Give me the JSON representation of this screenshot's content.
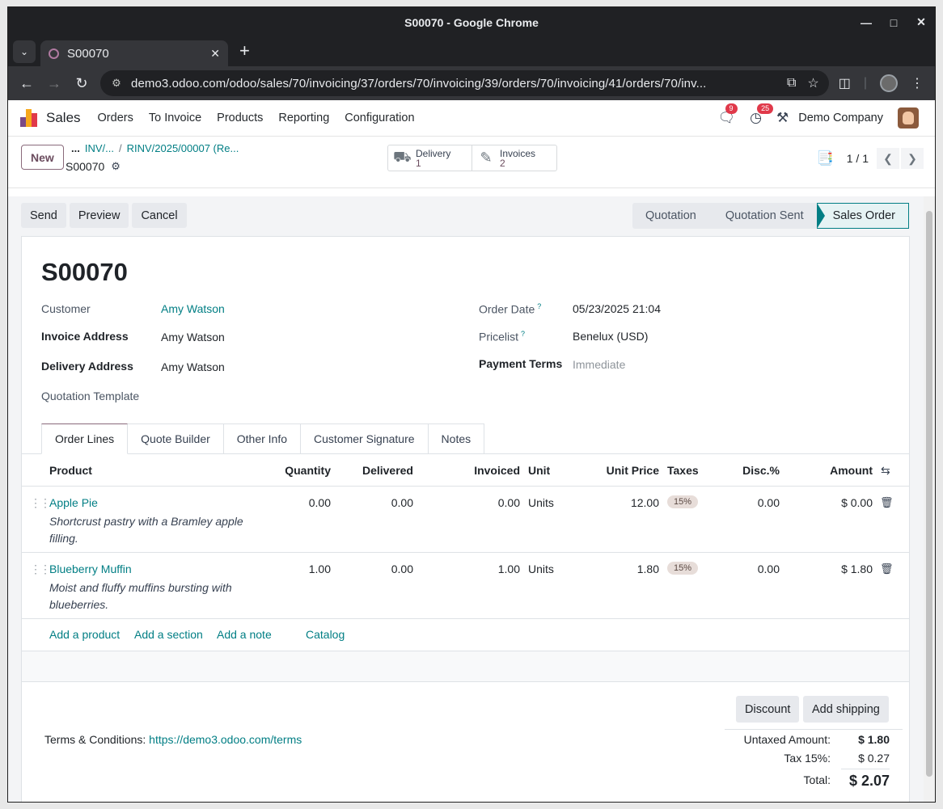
{
  "browser": {
    "window_title": "S00070 - Google Chrome",
    "tab_title": "S00070",
    "url": "demo3.odoo.com/odoo/sales/70/invoicing/37/orders/70/invoicing/39/orders/70/invoicing/41/orders/70/inv..."
  },
  "navbar": {
    "app_name": "Sales",
    "menus": [
      "Orders",
      "To Invoice",
      "Products",
      "Reporting",
      "Configuration"
    ],
    "chat_badge": "9",
    "activity_badge": "25",
    "company": "Demo Company"
  },
  "control_panel": {
    "new_label": "New",
    "breadcrumb_dots": "...",
    "breadcrumb_1": "INV/...",
    "breadcrumb_sep": "/",
    "breadcrumb_2": "RINV/2025/00007 (Re...",
    "current": "S00070",
    "delivery_label": "Delivery",
    "delivery_count": "1",
    "invoices_label": "Invoices",
    "invoices_count": "2",
    "pager": "1 / 1"
  },
  "actions": [
    "Send",
    "Preview",
    "Cancel"
  ],
  "statusbar": [
    "Quotation",
    "Quotation Sent",
    "Sales Order"
  ],
  "order": {
    "name": "S00070",
    "customer_label": "Customer",
    "customer": "Amy Watson",
    "invoice_address_label": "Invoice Address",
    "invoice_address": "Amy Watson",
    "delivery_address_label": "Delivery Address",
    "delivery_address": "Amy Watson",
    "quotation_template_label": "Quotation Template",
    "order_date_label": "Order Date",
    "order_date": "05/23/2025 21:04",
    "pricelist_label": "Pricelist",
    "pricelist": "Benelux (USD)",
    "payment_terms_label": "Payment Terms",
    "payment_terms_placeholder": "Immediate",
    "help_mark": "?"
  },
  "tabs": [
    "Order Lines",
    "Quote Builder",
    "Other Info",
    "Customer Signature",
    "Notes"
  ],
  "columns": {
    "product": "Product",
    "quantity": "Quantity",
    "delivered": "Delivered",
    "invoiced": "Invoiced",
    "unit": "Unit",
    "unit_price": "Unit Price",
    "taxes": "Taxes",
    "disc": "Disc.%",
    "amount": "Amount"
  },
  "lines": [
    {
      "product": "Apple Pie",
      "description": "Shortcrust pastry with a Bramley apple filling.",
      "quantity": "0.00",
      "delivered": "0.00",
      "invoiced": "0.00",
      "unit": "Units",
      "unit_price": "12.00",
      "tax": "15%",
      "disc": "0.00",
      "amount": "$ 0.00"
    },
    {
      "product": "Blueberry Muffin",
      "description": "Moist and fluffy muffins bursting with blueberries.",
      "quantity": "1.00",
      "delivered": "0.00",
      "invoiced": "1.00",
      "unit": "Units",
      "unit_price": "1.80",
      "tax": "15%",
      "disc": "0.00",
      "amount": "$ 1.80"
    }
  ],
  "add_links": [
    "Add a product",
    "Add a section",
    "Add a note",
    "Catalog"
  ],
  "footer": {
    "discount_label": "Discount",
    "shipping_label": "Add shipping",
    "terms_label": "Terms & Conditions:",
    "terms_link": "https://demo3.odoo.com/terms",
    "untaxed_label": "Untaxed Amount:",
    "untaxed": "$ 1.80",
    "tax_label": "Tax 15%:",
    "tax": "$ 0.27",
    "total_label": "Total:",
    "total": "$ 2.07"
  },
  "colors": {
    "primary": "#017e84",
    "accent": "#714b67"
  }
}
